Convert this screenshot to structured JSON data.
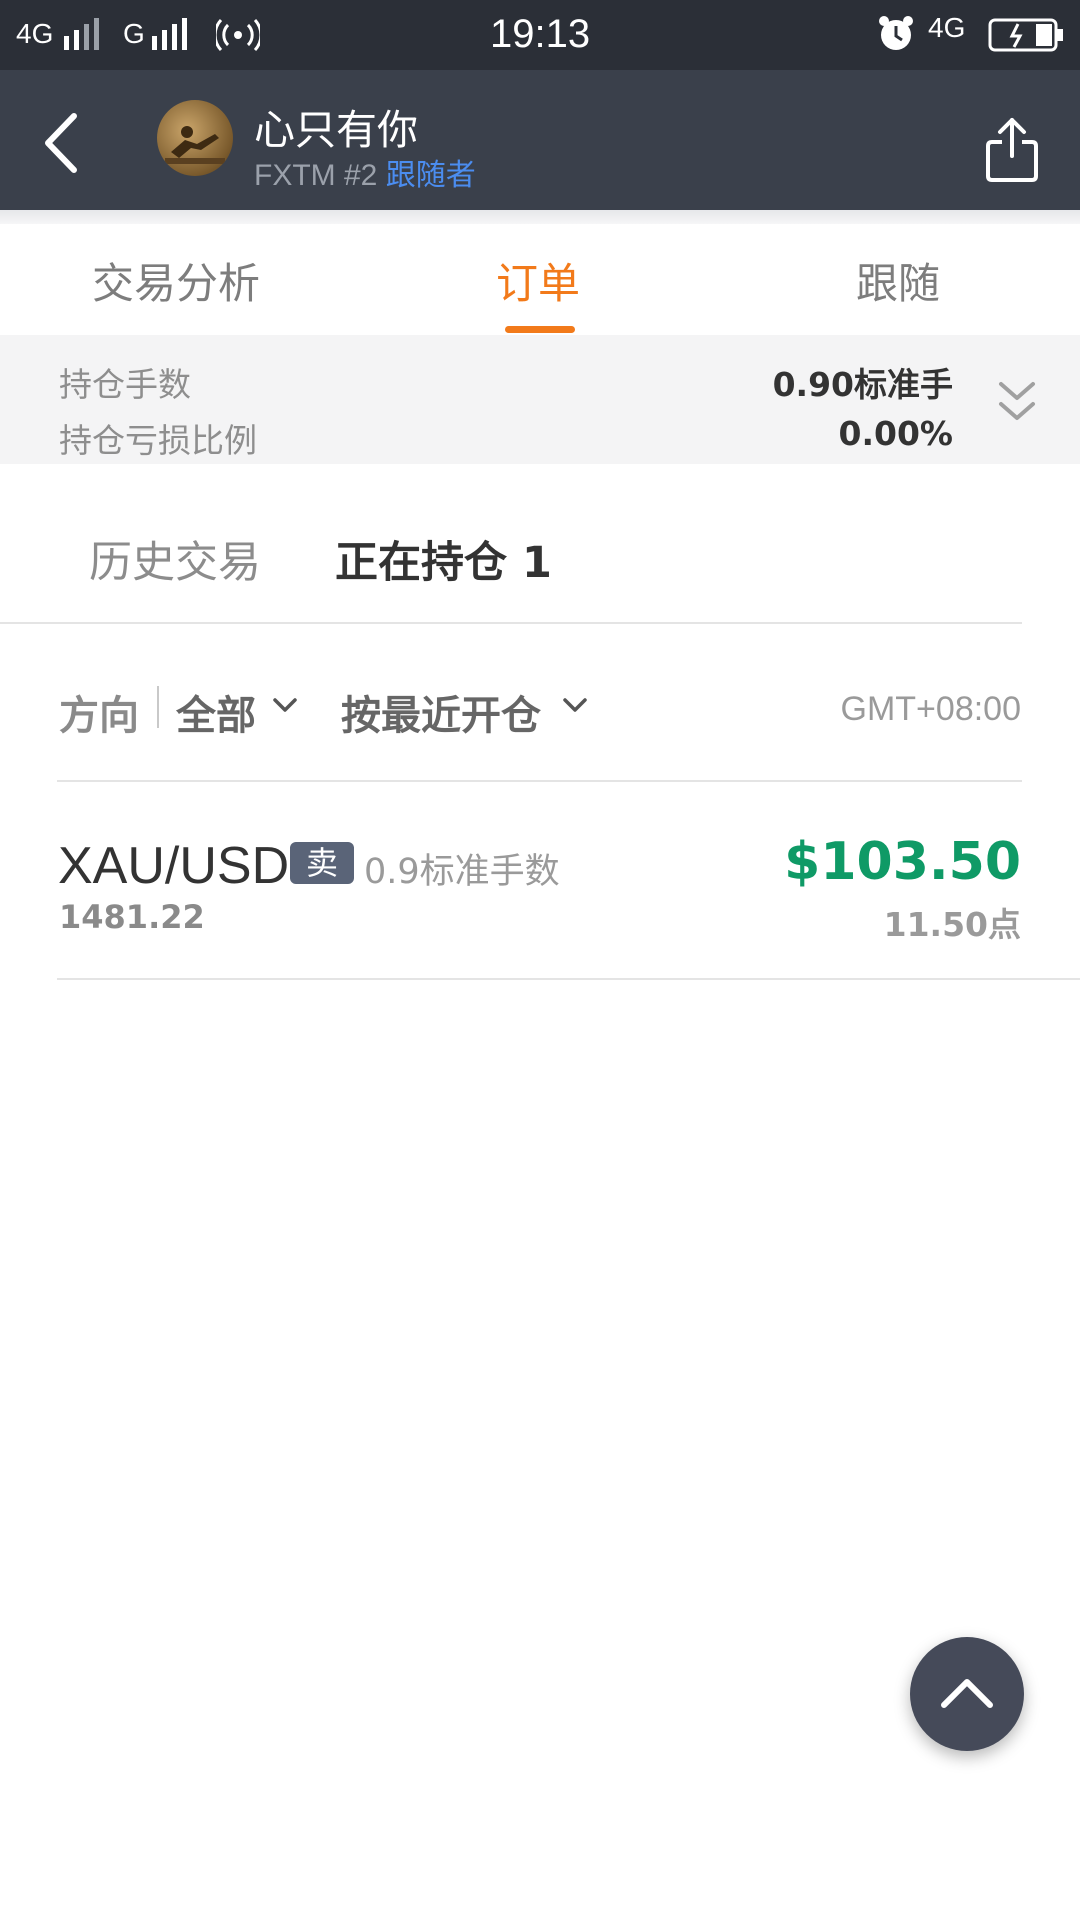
{
  "status_bar": {
    "left": "4G",
    "network2": "G",
    "time": "19:13",
    "right_network": "4G"
  },
  "header": {
    "title": "心只有你",
    "account": "FXTM #2",
    "role": "跟随者"
  },
  "tabs": [
    {
      "label": "交易分析",
      "active": false
    },
    {
      "label": "订单",
      "active": true
    },
    {
      "label": "跟随",
      "active": false
    }
  ],
  "summary": {
    "lots_label": "持仓手数",
    "lots_value": "0.90标准手",
    "pl_ratio_label": "持仓亏损比例",
    "pl_ratio_value": "0.00%"
  },
  "subtabs": {
    "history": "历史交易",
    "open": "正在持仓 1"
  },
  "filters": {
    "direction_label": "方向",
    "direction_value": "全部",
    "sort_value": "按最近开仓",
    "timezone": "GMT+08:00"
  },
  "orders": [
    {
      "symbol": "XAU/USD",
      "side": "卖",
      "lots": "0.9标准手数",
      "open_price": "1481.22",
      "profit": "$103.50",
      "points": "11.50点"
    }
  ],
  "colors": {
    "accent": "#f27a1a",
    "profit": "#0f9a66",
    "header_bg": "#3a404b",
    "role_link": "#4b8df0"
  },
  "icons": [
    "back-icon",
    "share-icon",
    "expand-double-chevron-icon",
    "chevron-down-icon",
    "scroll-top-icon"
  ]
}
